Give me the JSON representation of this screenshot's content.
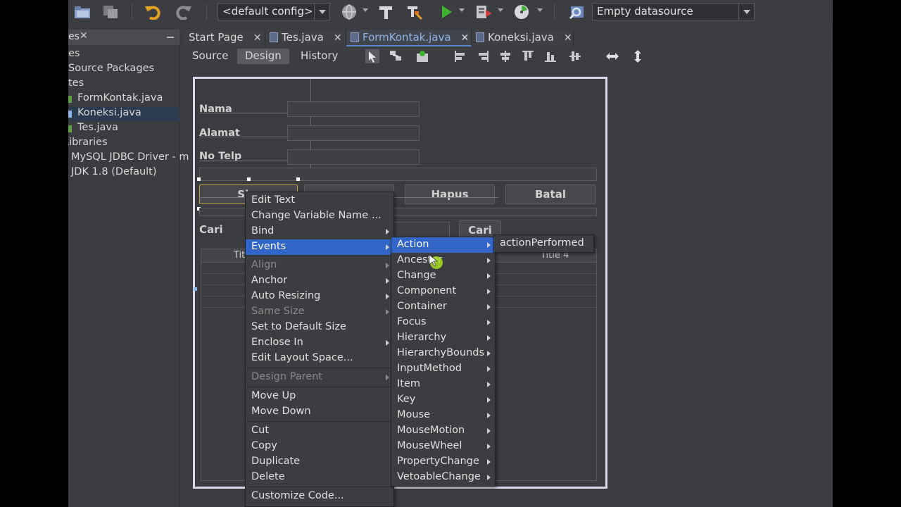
{
  "toolbar": {
    "config_combo": "<default config>",
    "datasource_combo": "Empty datasource"
  },
  "projects": {
    "header": "es",
    "items": [
      {
        "label": "es"
      },
      {
        "label": "Source Packages"
      },
      {
        "label": "tes"
      },
      {
        "label": "FormKontak.java"
      },
      {
        "label": "Koneksi.java"
      },
      {
        "label": "Tes.java"
      },
      {
        "label": "Libraries"
      },
      {
        "label": "MySQL JDBC Driver - m"
      },
      {
        "label": "JDK 1.8 (Default)"
      }
    ]
  },
  "tabs": [
    {
      "label": "Start Page"
    },
    {
      "label": "Tes.java"
    },
    {
      "label": "FormKontak.java"
    },
    {
      "label": "Koneksi.java"
    }
  ],
  "designer": {
    "source": "Source",
    "design": "Design",
    "history": "History"
  },
  "form": {
    "nama": "Nama",
    "alamat": "Alamat",
    "notelp": "No Telp",
    "btn_simpan_partial": "Sim",
    "btn_hapus": "Hapus",
    "btn_batal": "Batal",
    "cari_label": "Cari",
    "cari_button": "Cari",
    "col1_partial": "Tit",
    "col4": "Title 4"
  },
  "context_menu": [
    {
      "label": "Edit Text"
    },
    {
      "label": "Change Variable Name ..."
    },
    {
      "label": "Bind"
    },
    {
      "label": "Events"
    },
    {
      "label": "Align"
    },
    {
      "label": "Anchor"
    },
    {
      "label": "Auto Resizing"
    },
    {
      "label": "Same Size"
    },
    {
      "label": "Set to Default Size"
    },
    {
      "label": "Enclose In"
    },
    {
      "label": "Edit Layout Space..."
    },
    {
      "label": "Design Parent"
    },
    {
      "label": "Move Up"
    },
    {
      "label": "Move Down"
    },
    {
      "label": "Cut"
    },
    {
      "label": "Copy"
    },
    {
      "label": "Duplicate"
    },
    {
      "label": "Delete"
    },
    {
      "label": "Customize Code..."
    }
  ],
  "events_menu": [
    {
      "label": "Action"
    },
    {
      "label": "Ancestor"
    },
    {
      "label": "Change"
    },
    {
      "label": "Component"
    },
    {
      "label": "Container"
    },
    {
      "label": "Focus"
    },
    {
      "label": "Hierarchy"
    },
    {
      "label": "HierarchyBounds"
    },
    {
      "label": "InputMethod"
    },
    {
      "label": "Item"
    },
    {
      "label": "Key"
    },
    {
      "label": "Mouse"
    },
    {
      "label": "MouseMotion"
    },
    {
      "label": "MouseWheel"
    },
    {
      "label": "PropertyChange"
    },
    {
      "label": "VetoableChange"
    }
  ],
  "action_menu": [
    {
      "label": "actionPerformed"
    }
  ],
  "colors": {
    "highlight": "#3165c8",
    "background": "#3b3c40"
  }
}
